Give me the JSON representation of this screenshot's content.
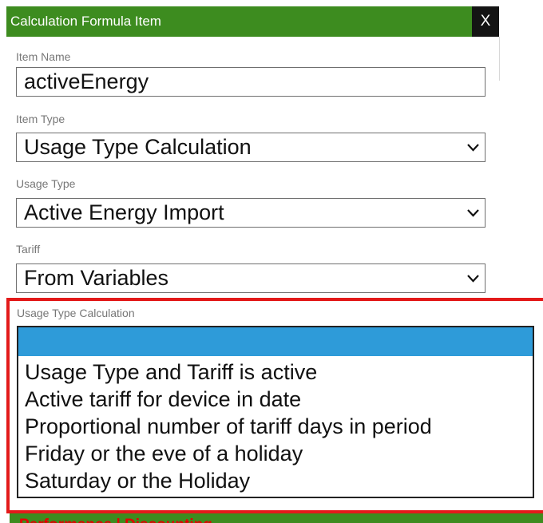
{
  "dialog": {
    "title": "Calculation Formula Item",
    "close_label": "X"
  },
  "fields": {
    "item_name": {
      "label": "Item Name",
      "value": "activeEnergy"
    },
    "item_type": {
      "label": "Item Type",
      "value": "Usage Type Calculation"
    },
    "usage_type": {
      "label": "Usage Type",
      "value": "Active Energy Import"
    },
    "tariff": {
      "label": "Tariff",
      "value": "From Variables"
    },
    "usage_type_calculation": {
      "label": "Usage Type Calculation",
      "options": [
        "",
        "Usage Type and Tariff is active",
        "Active tariff for device in date",
        "Proportional number of tariff days in period",
        "Friday or the eve of a holiday",
        "Saturday or the Holiday"
      ],
      "selected_index": 0
    }
  },
  "bottom": {
    "text": "Performance | Discounting"
  },
  "colors": {
    "titlebar": "#3d8c1f",
    "close_button": "#141414",
    "highlight_border": "#e31a1a",
    "selected_option": "#2e9bd9"
  },
  "icons": {
    "dropdown": "chevron-down-icon",
    "close": "close-icon"
  }
}
